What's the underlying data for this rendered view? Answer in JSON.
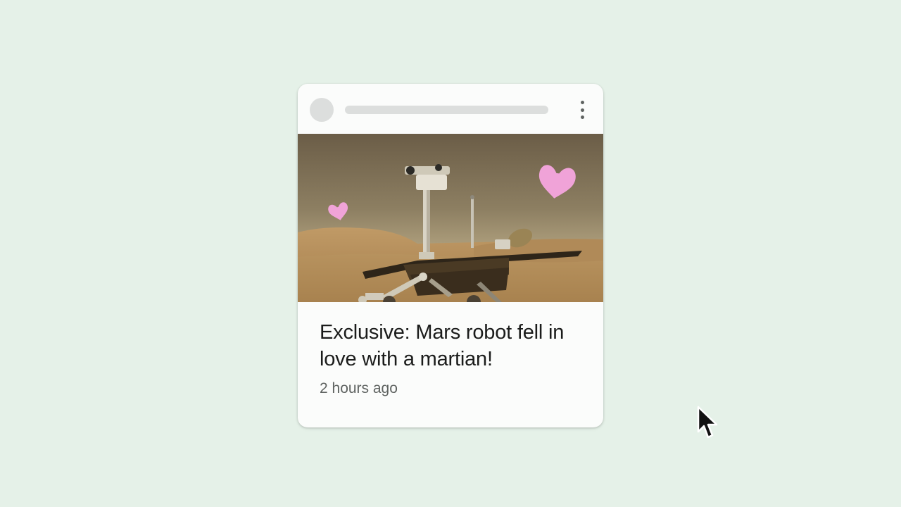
{
  "card": {
    "headline": "Exclusive: Mars robot fell in love with a martian!",
    "timestamp": "2 hours ago",
    "image_description_alt": "Mars rover with pink hearts"
  },
  "colors": {
    "background": "#e5f1e8",
    "card": "#fbfcfb",
    "placeholder": "#dcdedd",
    "heart": "#f0a3d8",
    "headline_text": "#1b1c1b",
    "meta_text": "#5f6361"
  },
  "icons": {
    "menu": "more-vert-icon",
    "hearts": "heart-icon",
    "cursor": "mouse-pointer-icon"
  }
}
